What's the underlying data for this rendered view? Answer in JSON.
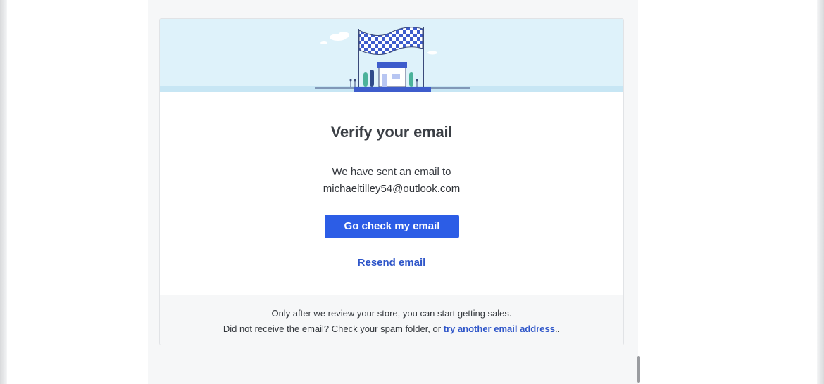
{
  "card": {
    "title": "Verify your email",
    "sent_text": "We have sent an email to",
    "email": "michaeltilley54@outlook.com",
    "primary_button": "Go check my email",
    "resend_link": "Resend email"
  },
  "footer": {
    "line1": "Only after we review your store, you can start getting sales.",
    "line2_prefix": "Did not receive the email? Check your spam folder, or ",
    "line2_link": "try another email address",
    "line2_suffix": ".."
  },
  "icons": {
    "hero": "checkered-flag-store-illustration"
  },
  "colors": {
    "accent": "#2c5de6",
    "link": "#2f56c9",
    "hero_bg": "#def2fa",
    "title": "#3b3f45"
  }
}
